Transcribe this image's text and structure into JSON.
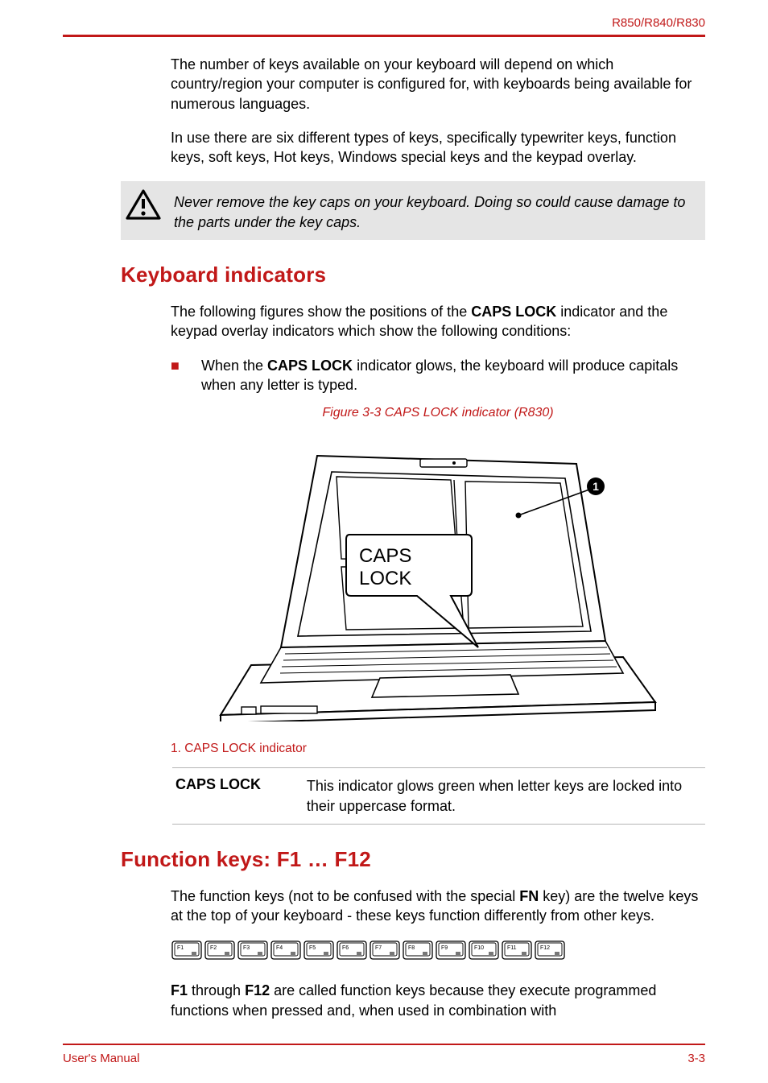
{
  "header": {
    "product_line": "R850/R840/R830"
  },
  "paragraphs": {
    "p1": "The number of keys available on your keyboard will depend on which country/region your computer is configured for, with keyboards being available for numerous languages.",
    "p2": "In use there are six different types of keys, specifically typewriter keys, function keys, soft keys, Hot keys, Windows special keys and the keypad overlay.",
    "warning": "Never remove the key caps on your keyboard. Doing so could cause damage to the parts under the key caps.",
    "kb_intro_pre": "The following figures show the positions of the ",
    "kb_intro_bold": "CAPS LOCK",
    "kb_intro_post": " indicator and the keypad overlay indicators which show the following conditions:",
    "bullet1_pre": "When the ",
    "bullet1_bold": "CAPS LOCK",
    "bullet1_post": " indicator glows, the keyboard will produce capitals when any letter is typed.",
    "figure_caption": "Figure 3-3 CAPS LOCK indicator (R830)",
    "figure_legend": "1. CAPS LOCK indicator",
    "capslock_term": "CAPS LOCK",
    "capslock_desc": "This indicator glows green when letter keys are locked into their uppercase format.",
    "fn_intro_pre": "The function keys (not to be confused with the special ",
    "fn_intro_bold": "FN",
    "fn_intro_post": " key) are the twelve keys at the top of your keyboard - these keys function differently from other keys.",
    "fn_outro_b1": "F1",
    "fn_outro_mid": " through ",
    "fn_outro_b2": "F12",
    "fn_outro_post": " are called function keys because they execute programmed functions when pressed and, when used in combination with"
  },
  "headings": {
    "keyboard_indicators": "Keyboard indicators",
    "function_keys": "Function keys: F1 … F12"
  },
  "figure": {
    "caps_text_1": "CAPS",
    "caps_text_2": "LOCK"
  },
  "footer": {
    "left": "User's Manual",
    "right": "3-3"
  },
  "fkeys": [
    "F1",
    "F2",
    "F3",
    "F4",
    "F5",
    "F6",
    "F7",
    "F8",
    "F9",
    "F10",
    "F11",
    "F12"
  ]
}
